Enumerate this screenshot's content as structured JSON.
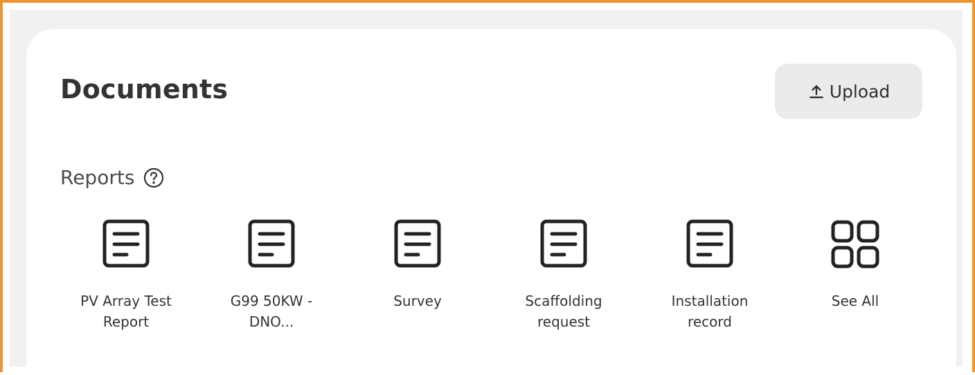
{
  "documents": {
    "title": "Documents",
    "upload_label": "Upload",
    "upload_icon": "upload-icon"
  },
  "reports": {
    "title": "Reports",
    "help_icon": "help-circle-icon",
    "items": [
      {
        "label": "PV Array Test\nReport",
        "icon": "document-icon"
      },
      {
        "label": "G99 50KW -\nDNO...",
        "icon": "document-icon"
      },
      {
        "label": "Survey",
        "icon": "document-icon"
      },
      {
        "label": "Scaffolding\nrequest",
        "icon": "document-icon"
      },
      {
        "label": "Installation\nrecord",
        "icon": "document-icon"
      },
      {
        "label": "See All",
        "icon": "grid-icon"
      }
    ]
  },
  "colors": {
    "accent_border": "#f0952e",
    "backdrop": "#f1f1f1",
    "button_bg": "#ebebeb",
    "text": "#333333"
  }
}
